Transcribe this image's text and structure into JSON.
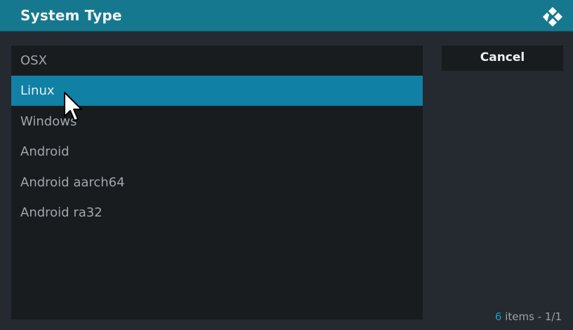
{
  "dialog": {
    "title": "System Type",
    "logo_icon": "kodi-logo-icon",
    "cancel_label": "Cancel"
  },
  "list": {
    "items": [
      {
        "label": "OSX",
        "selected": false
      },
      {
        "label": "Linux",
        "selected": true
      },
      {
        "label": "Windows",
        "selected": false
      },
      {
        "label": "Android",
        "selected": false
      },
      {
        "label": "Android aarch64",
        "selected": false
      },
      {
        "label": "Android ra32",
        "selected": false
      }
    ]
  },
  "footer": {
    "item_count": "6",
    "items_label": " items - ",
    "page": "1/1"
  },
  "colors": {
    "titlebar": "#16788f",
    "selected": "#1080a5",
    "panel": "#181c1f",
    "accent": "#1d9ac0"
  }
}
